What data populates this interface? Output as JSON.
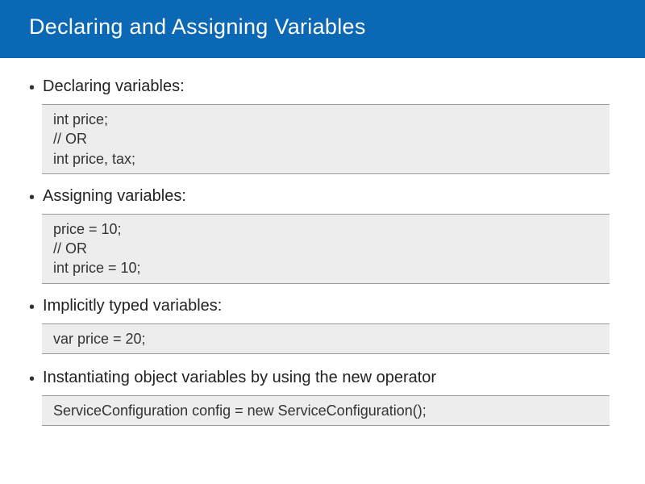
{
  "title": "Declaring and Assigning Variables",
  "sections": [
    {
      "label": "Declaring variables:",
      "code": [
        "int price;",
        "// OR",
        "int price, tax;"
      ]
    },
    {
      "label": "Assigning variables:",
      "code": [
        "price = 10;",
        "// OR",
        "int price = 10;"
      ]
    },
    {
      "label": "Implicitly typed variables:",
      "code": [
        "var price = 20;"
      ]
    },
    {
      "label": "Instantiating object variables by using the new operator",
      "code": [
        "ServiceConfiguration config = new ServiceConfiguration();"
      ]
    }
  ]
}
